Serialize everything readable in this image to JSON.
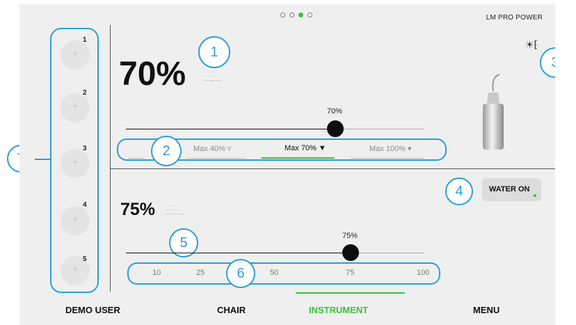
{
  "header": {
    "brand": "LM PRO POWER",
    "page_dots": 4,
    "active_page": 2
  },
  "memory_slots": [
    {
      "label": "1",
      "icon": "plus-icon"
    },
    {
      "label": "2",
      "icon": "plus-icon"
    },
    {
      "label": "3",
      "icon": "plus-icon"
    },
    {
      "label": "4",
      "icon": "plus-icon"
    },
    {
      "label": "5",
      "icon": "plus-icon"
    }
  ],
  "power": {
    "value": "70%",
    "slider_label": "70%",
    "slider_fraction": 0.7,
    "modes": [
      {
        "label": "Max 40%",
        "selected": false
      },
      {
        "label": "Max 70%",
        "selected": true
      },
      {
        "label": "Max 100%",
        "selected": false
      }
    ]
  },
  "water": {
    "value": "75%",
    "slider_label": "75%",
    "slider_fraction": 0.75,
    "button": "WATER ON",
    "scale": [
      "10",
      "25",
      "50",
      "75",
      "100"
    ]
  },
  "nav": [
    {
      "label": "DEMO USER",
      "active": false
    },
    {
      "label": "CHAIR",
      "active": false
    },
    {
      "label": "INSTRUMENT",
      "active": true
    },
    {
      "label": "MENU",
      "active": false
    }
  ],
  "callouts": [
    "1",
    "2",
    "3",
    "4",
    "5",
    "6",
    "7"
  ],
  "colors": {
    "accent": "#39c239",
    "callout": "#2a9fd6",
    "background": "#efefef"
  }
}
